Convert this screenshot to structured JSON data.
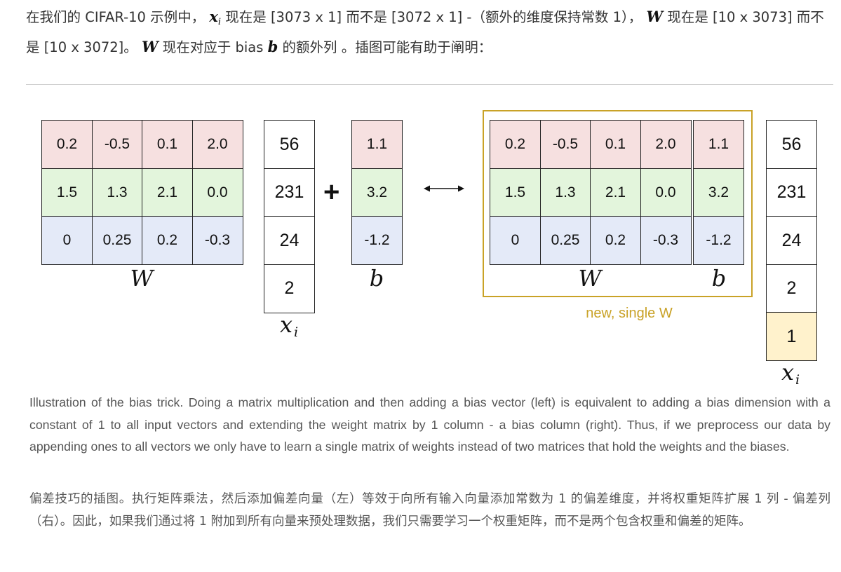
{
  "intro": {
    "p1": "在我们的 CIFAR-10 示例中，",
    "x": "x",
    "i": "i",
    "p2": " 现在是 [3073 x 1] 而不是 [3072 x 1] -（额外的维度保持常数 1），",
    "W1": "W",
    "p3": " 现在是 [10 x 3073] 而不是 [10 x 3072]。",
    "W2": "W",
    "p4": " 现在对应于 bias ",
    "b": "b",
    "p5": " 的额外列 。插图可能有助于阐明："
  },
  "figure": {
    "left": {
      "W_rows": [
        [
          "0.2",
          "-0.5",
          "0.1",
          "2.0"
        ],
        [
          "1.5",
          "1.3",
          "2.1",
          "0.0"
        ],
        [
          "0",
          "0.25",
          "0.2",
          "-0.3"
        ]
      ],
      "x": [
        "56",
        "231",
        "24",
        "2"
      ],
      "b": [
        "1.1",
        "3.2",
        "-1.2"
      ],
      "W_label": "W",
      "x_label": "x",
      "x_sub": "i",
      "b_label": "b",
      "plus": "+"
    },
    "arrow": "⟷",
    "right": {
      "W_rows": [
        [
          "0.2",
          "-0.5",
          "0.1",
          "2.0",
          "1.1"
        ],
        [
          "1.5",
          "1.3",
          "2.1",
          "0.0",
          "3.2"
        ],
        [
          "0",
          "0.25",
          "0.2",
          "-0.3",
          "-1.2"
        ]
      ],
      "x": [
        "56",
        "231",
        "24",
        "2",
        "1"
      ],
      "W_label": "W",
      "b_label": "b",
      "x_label": "x",
      "x_sub": "i",
      "new_label": "new, single W"
    },
    "row_colors": [
      "#f6e0e0",
      "#e3f5dc",
      "#e4eaf8"
    ],
    "highlight_color": "#fff2cc",
    "frame_color": "#c9a227"
  },
  "caption_en": "Illustration of the bias trick. Doing a matrix multiplication and then adding a bias vector (left) is equivalent to adding a bias dimension with a constant of 1 to all input vectors and extending the weight matrix by 1 column - a bias column (right). Thus, if we preprocess our data by appending ones to all vectors we only have to learn a single matrix of weights instead of two matrices that hold the weights and the biases.",
  "caption_zh": "偏差技巧的插图。执行矩阵乘法，然后添加偏差向量（左）等效于向所有输入向量添加常数为 1 的偏差维度，并将权重矩阵扩展 1 列 - 偏差列（右）。因此，如果我们通过将 1 附加到所有向量来预处理数据，我们只需要学习一个权重矩阵，而不是两个包含权重和偏差的矩阵。"
}
